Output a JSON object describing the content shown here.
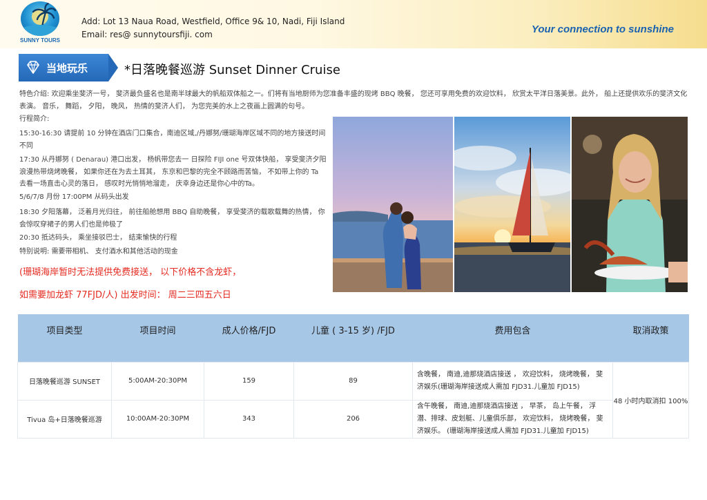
{
  "header": {
    "logo_text": "SUNNY TOURS",
    "address": "Add:  Lot 13  Naua Road,  Westfield,  Office 9& 10,  Nadi,  Fiji Island",
    "email": "Email:   res@ sunnytoursfiji. com",
    "slogan": "Your  connection  to  sunshine"
  },
  "section": {
    "tag": "当地玩乐",
    "icon": "diamond-icon",
    "title": "*日落晚餐巡游  Sunset  Dinner  Cruise"
  },
  "intro": "特色介绍:   欢迎乘坐斐济一号，   斐济最负盛名也是南半球最大的帆船双体船之一。们将有当地厨师为您准备丰盛的现烤 BBQ 晚餐，   您还可享用免费的欢迎饮料，   欣赏太平洋日落美景。此外，   船上还提供欢乐的斐济文化表演。   音乐，    舞蹈，    夕阳，    晚风，    热情的斐济人们，    为您完美的水上之夜画上圆满的句号。",
  "itinerary": {
    "heading": "行程简介:",
    "lines": [
      "15:30-16:30      请提前 10 分钟在酒店门口集合，南迪区域,/丹娜努/珊瑚海岸区域不同的地方接送时间不同",
      "17:30      从丹娜努  ( Denarau)  港口出发，   杨帆带您去一 日探险  FIJI one 号双体快船，    享受斐济夕阳浪漫热带烧烤晚餐，    如果你还在为去土耳其，    东京和巴黎的完全不顾路而苦恼，   不如带上你的  Ta  去看一场直击心灵的落日，    感叹时光悄悄地溜走，    庆幸身边还是你心中的Ta。",
      "5/6/7/8 月份 17:00PM 从码头出发",
      "18:30      夕阳落幕，    泛着月光归往，    前往船舱想用  BBQ 自助晚餐，    享受斐济的载歌载舞的热情，    你会惊叹穿裙子的男人们也是帅极了",
      "20:30      抵达码头，    乘坐接驳巴士，    结束愉快的行程",
      "特别说明:    需要带相机、    支付酒水和其他活动的现金"
    ]
  },
  "notices": [
    "(珊瑚海岸暂时无法提供免费接送，    以下价格不含龙虾，",
    "如需要加龙虾  77FJD/人)   出发时间：    周二三四五六日"
  ],
  "table": {
    "headers": [
      "项目类型",
      "项目时间",
      "成人价格/FJD",
      "儿童  ( 3-15 岁)  /FJD",
      "费用包含",
      "取消政策"
    ],
    "rows": [
      {
        "type": "日落晚餐巡游    SUNSET",
        "time": "5:00AM-20:30PM",
        "adult": "159",
        "child": "89",
        "includes": "含晚餐，    南迪,迪那烧酒店接送  ，   欢迎饮料，    烧烤晚餐，    斐济娱乐(珊瑚海岸接送成人需加 FJD31.儿童加 FJD15)"
      },
      {
        "type": "Tivua 岛+日落晚餐巡游",
        "time": "10:00AM-20:30PM",
        "adult": "343",
        "child": "206",
        "includes": "含午晚餐，    南迪,迪那烧酒店接送  ，   早茶，    岛上午餐，    浮潜、排球、皮划艇、儿童俱乐部，    欢迎饮料，    烧烤晚餐，    斐济娱乐。   (珊瑚海岸接送成人需加 FJD31.儿童加 FJD15)"
      }
    ],
    "cancel_policy": "48 小时内取消扣 100%"
  },
  "colors": {
    "header_blue": "#1a62b0",
    "tag_blue": "#2469b8",
    "notice_red": "#e52a20",
    "table_head": "#a7c7e7"
  }
}
